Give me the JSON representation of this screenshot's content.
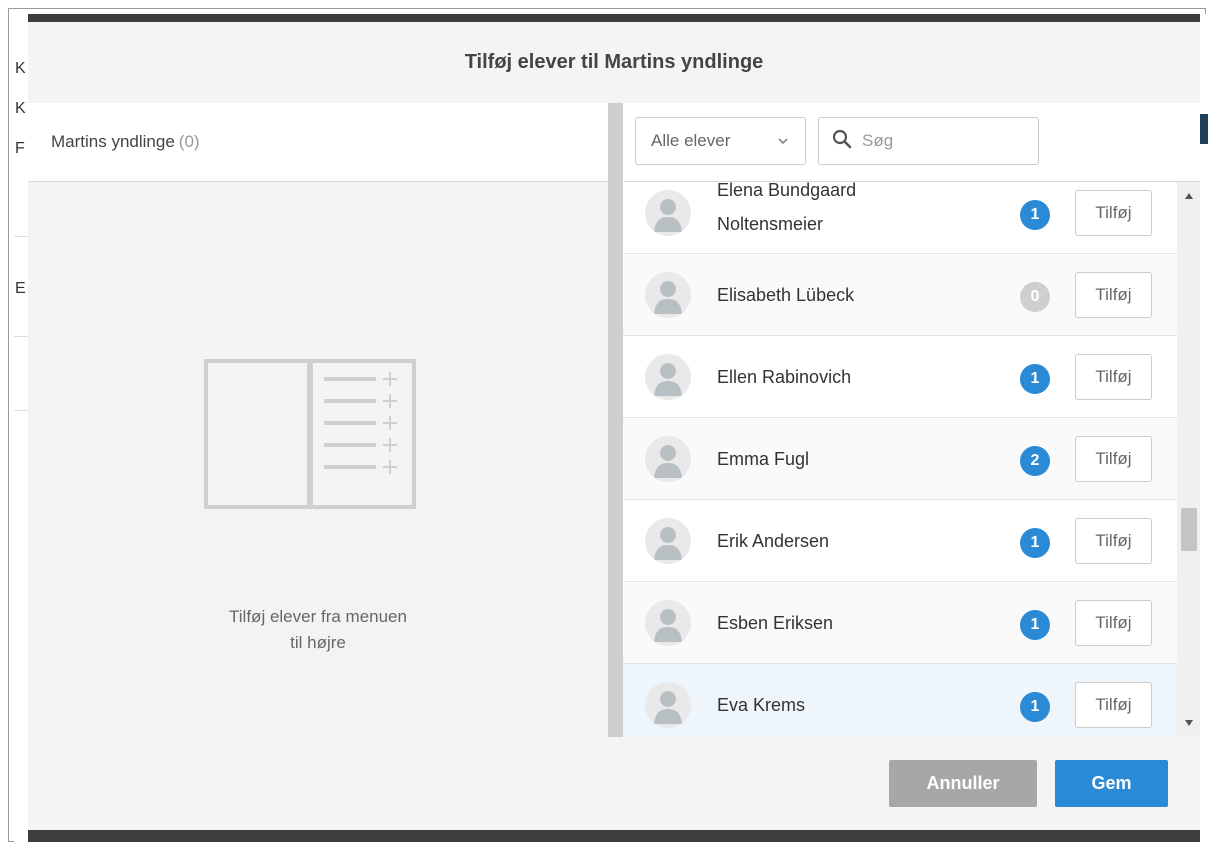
{
  "modal": {
    "title": "Tilføj elever til Martins yndlinge"
  },
  "left_pane": {
    "group_name": "Martins yndlinge",
    "group_count": "(0)",
    "empty_line1": "Tilføj elever fra menuen",
    "empty_line2": "til højre"
  },
  "right_pane": {
    "filter_selected": "Alle elever",
    "search_placeholder": "Søg",
    "students": [
      {
        "name_line1": "Elena Bundgaard",
        "name_line2": "Noltensmeier",
        "count": "1",
        "add_label": "Tilføj"
      },
      {
        "name": "Elisabeth Lübeck",
        "count": "0",
        "add_label": "Tilføj"
      },
      {
        "name": "Ellen Rabinovich",
        "count": "1",
        "add_label": "Tilføj"
      },
      {
        "name": "Emma Fugl",
        "count": "2",
        "add_label": "Tilføj"
      },
      {
        "name": "Erik Andersen",
        "count": "1",
        "add_label": "Tilføj"
      },
      {
        "name": "Esben Eriksen",
        "count": "1",
        "add_label": "Tilføj"
      },
      {
        "name": "Eva Krems",
        "count": "1",
        "add_label": "Tilføj"
      }
    ]
  },
  "footer": {
    "cancel_label": "Annuller",
    "save_label": "Gem"
  },
  "colors": {
    "accent": "#2a8ad6",
    "badge_zero": "#cfcfcf",
    "cancel": "#a7a7a7",
    "divider": "#cfcfcf"
  },
  "icons": [
    "chevron-down-icon",
    "search-icon",
    "avatar-icon",
    "empty-list-icon",
    "scroll-up-icon",
    "scroll-down-icon"
  ]
}
